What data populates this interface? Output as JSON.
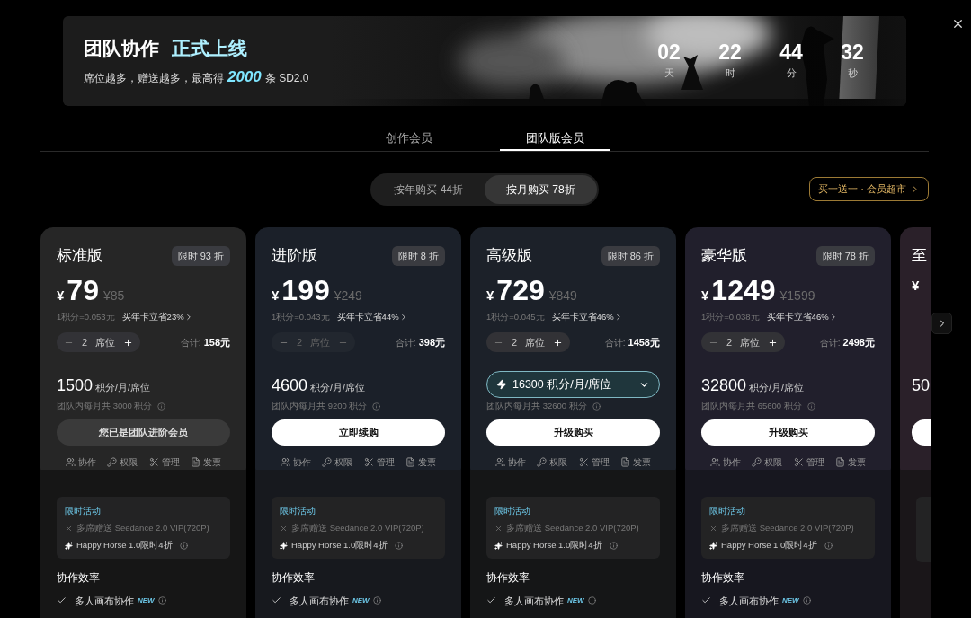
{
  "banner": {
    "title": "团队协作",
    "title_highlight": "正式上线",
    "subtitle_before": "席位越多，赠送越多，最高得",
    "subtitle_highlight": "2000",
    "subtitle_after": "条 SD2.0",
    "countdown": [
      {
        "value": "02",
        "unit": "天"
      },
      {
        "value": "22",
        "unit": "时"
      },
      {
        "value": "44",
        "unit": "分"
      },
      {
        "value": "32",
        "unit": "秒"
      }
    ]
  },
  "tabs": [
    {
      "label": "创作会员",
      "selected": false
    },
    {
      "label": "团队版会员",
      "selected": true
    }
  ],
  "billing": [
    {
      "label": "按年购买 44折",
      "selected": false
    },
    {
      "label": "按月购买 78折",
      "selected": true
    }
  ],
  "promo_link": "买一送一 · 会员超市",
  "plans": [
    {
      "kind": "full",
      "title": "标准版",
      "badge": "限时 93 折",
      "currency": "¥",
      "price": "79",
      "original_price": "¥85",
      "rate": "1积分=0.053元",
      "annual_link": "买年卡立省23%",
      "stepper": {
        "count": "2",
        "unit": "席位",
        "disabled": false
      },
      "total_label": "合计:",
      "total": "158元",
      "credits": {
        "kind": "static",
        "amount": "1500",
        "unit": "积分/月/席位"
      },
      "team_credits": "团队内每月共 3000 积分",
      "button": {
        "kind": "owned",
        "label": "您已是团队进阶会员"
      },
      "features": [
        "协作",
        "权限",
        "管理",
        "发票"
      ],
      "promo": {
        "title": "限时活动",
        "items": [
          {
            "kind": "excluded",
            "text": "多席赠送 Seedance 2.0 VIP(720P)"
          },
          {
            "kind": "spark",
            "text": "Happy Horse 1.0限时4折"
          }
        ]
      },
      "section": "协作效率",
      "section_items": [
        {
          "text": "多人画布协作",
          "badge": "NEW"
        }
      ]
    },
    {
      "kind": "full",
      "title": "进阶版",
      "badge": "限时 8 折",
      "currency": "¥",
      "price": "199",
      "original_price": "¥249",
      "rate": "1积分=0.043元",
      "annual_link": "买年卡立省44%",
      "stepper": {
        "count": "2",
        "unit": "席位",
        "disabled": true
      },
      "total_label": "合计:",
      "total": "398元",
      "credits": {
        "kind": "static",
        "amount": "4600",
        "unit": "积分/月/席位"
      },
      "team_credits": "团队内每月共 9200 积分",
      "button": {
        "kind": "primary",
        "label": "立即续购"
      },
      "features": [
        "协作",
        "权限",
        "管理",
        "发票"
      ],
      "promo": {
        "title": "限时活动",
        "items": [
          {
            "kind": "excluded",
            "text": "多席赠送 Seedance 2.0 VIP(720P)"
          },
          {
            "kind": "spark",
            "text": "Happy Horse 1.0限时4折"
          }
        ]
      },
      "section": "协作效率",
      "section_items": [
        {
          "text": "多人画布协作",
          "badge": "NEW"
        }
      ]
    },
    {
      "kind": "full",
      "title": "高级版",
      "badge": "限时 86 折",
      "currency": "¥",
      "price": "729",
      "original_price": "¥849",
      "rate": "1积分=0.045元",
      "annual_link": "买年卡立省46%",
      "stepper": {
        "count": "2",
        "unit": "席位",
        "disabled": false
      },
      "total_label": "合计:",
      "total": "1458元",
      "credits": {
        "kind": "dropdown",
        "amount": "16300",
        "unit": "积分/月/席位"
      },
      "team_credits": "团队内每月共 32600 积分",
      "button": {
        "kind": "primary",
        "label": "升级购买"
      },
      "features": [
        "协作",
        "权限",
        "管理",
        "发票"
      ],
      "promo": {
        "title": "限时活动",
        "items": [
          {
            "kind": "excluded",
            "text": "多席赠送 Seedance 2.0 VIP(720P)"
          },
          {
            "kind": "spark",
            "text": "Happy Horse 1.0限时4折"
          }
        ]
      },
      "section": "协作效率",
      "section_items": [
        {
          "text": "多人画布协作",
          "badge": "NEW"
        }
      ]
    },
    {
      "kind": "full",
      "title": "豪华版",
      "badge": "限时 78 折",
      "currency": "¥",
      "price": "1249",
      "original_price": "¥1599",
      "rate": "1积分=0.038元",
      "annual_link": "买年卡立省46%",
      "stepper": {
        "count": "2",
        "unit": "席位",
        "disabled": false
      },
      "total_label": "合计:",
      "total": "2498元",
      "credits": {
        "kind": "static",
        "amount": "32800",
        "unit": "积分/月/席位"
      },
      "team_credits": "团队内每月共 65600 积分",
      "button": {
        "kind": "primary",
        "label": "升级购买"
      },
      "features": [
        "协作",
        "权限",
        "管理",
        "发票"
      ],
      "promo": {
        "title": "限时活动",
        "items": [
          {
            "kind": "excluded",
            "text": "多席赠送 Seedance 2.0 VIP(720P)"
          },
          {
            "kind": "spark",
            "text": "Happy Horse 1.0限时4折"
          }
        ]
      },
      "section": "协作效率",
      "section_items": [
        {
          "text": "多人画布协作",
          "badge": "NEW"
        }
      ]
    },
    {
      "kind": "partial",
      "title": "至",
      "currency": "¥",
      "credits": {
        "kind": "static",
        "amount": "50"
      },
      "button": {
        "kind": "primary"
      }
    }
  ]
}
